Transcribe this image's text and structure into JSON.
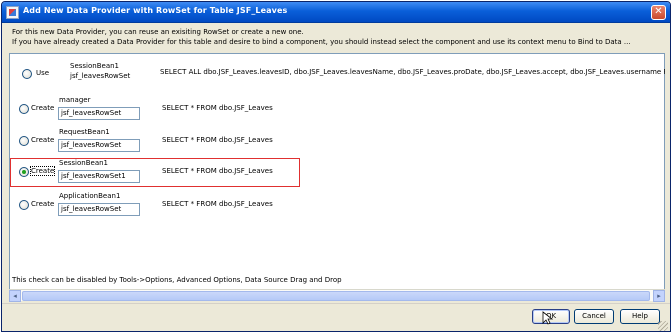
{
  "window": {
    "title": "Add New Data Provider with RowSet for Table JSF_Leaves"
  },
  "instructions": {
    "line1": "For this new Data Provider, you can reuse an exisiting RowSet or create a new one.",
    "line2": "If you have already created a Data Provider for this table and desire to bind a component, you should instead select the component and use its context menu to Bind to Data ..."
  },
  "options": [
    {
      "radio_label": "Use",
      "scope": "SessionBean1",
      "rowset": "jsf_leavesRowSet",
      "sql": "SELECT ALL dbo.JSF_Leaves.leavesID, dbo.JSF_Leaves.leavesName, dbo.JSF_Leaves.proDate, dbo.JSF_Leaves.accept, dbo.JSF_Leaves.username  FROM dbo.JSF_Leaves",
      "checked": false
    },
    {
      "radio_label": "Create",
      "scope": "manager",
      "rowset": "jsf_leavesRowSet",
      "sql": "SELECT * FROM dbo.JSF_Leaves",
      "checked": false
    },
    {
      "radio_label": "Create",
      "scope": "RequestBean1",
      "rowset": "jsf_leavesRowSet",
      "sql": "SELECT * FROM dbo.JSF_Leaves",
      "checked": false
    },
    {
      "radio_label": "Create",
      "scope": "SessionBean1",
      "rowset": "jsf_leavesRowSet1",
      "sql": "SELECT * FROM dbo.JSF_Leaves",
      "checked": true
    },
    {
      "radio_label": "Create",
      "scope": "ApplicationBean1",
      "rowset": "jsf_leavesRowSet",
      "sql": "SELECT * FROM dbo.JSF_Leaves",
      "checked": false
    }
  ],
  "status_note": "This check can be disabled by Tools->Options, Advanced Options, Data Source Drag and Drop",
  "buttons": {
    "ok": "OK",
    "cancel": "Cancel",
    "help": "Help"
  },
  "colors": {
    "title_bar": "#0a5fd9",
    "highlight_border": "#e03030",
    "selected_radio": "#21a121"
  }
}
